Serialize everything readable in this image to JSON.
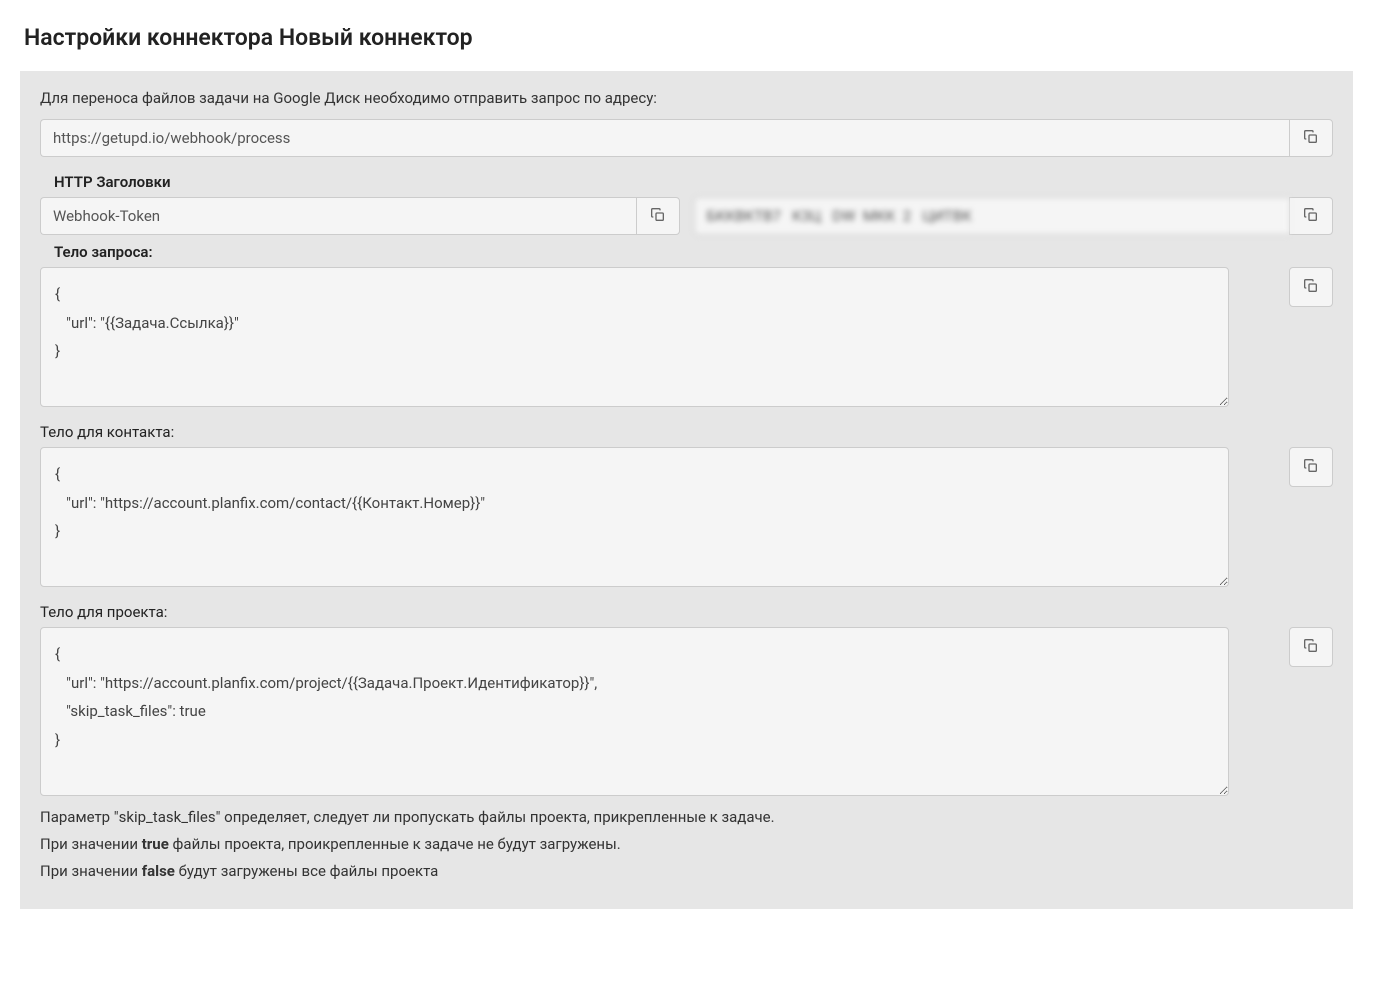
{
  "title": "Настройки коннектора Новый коннектор",
  "description": "Для переноса файлов задачи на Google Диск необходимо отправить запрос по адресу:",
  "webhook_url": "https://getupd.io/webhook/process",
  "headers_section_title": "HTTP Заголовки",
  "header_name": "Webhook-Token",
  "header_value": "БККВКТВ7   К3Ц   DW  МКК  2   ЦИТВК",
  "body_section_title": "Тело запроса:",
  "body_task": "{\n   \"url\": \"{{Задача.Ссылка}}\"\n}",
  "body_contact_label": "Тело для контакта:",
  "body_contact": "{\n   \"url\": \"https://account.planfix.com/contact/{{Контакт.Номер}}\"\n}",
  "body_project_label": "Тело для проекта:",
  "body_project": "{\n   \"url\": \"https://account.planfix.com/project/{{Задача.Проект.Идентификатор}}\",\n   \"skip_task_files\": true\n}",
  "note_line1_a": "Параметр \"skip_task_files\" определяет, следует ли пропускать файлы проекта, прикрепленные к задаче.",
  "note_line2_a": "При значении ",
  "note_line2_bold": "true",
  "note_line2_b": " файлы проекта, проикрепленные к задаче не будут загружены.",
  "note_line3_a": "При значении ",
  "note_line3_bold": "false",
  "note_line3_b": " будут загружены все файлы проекта"
}
